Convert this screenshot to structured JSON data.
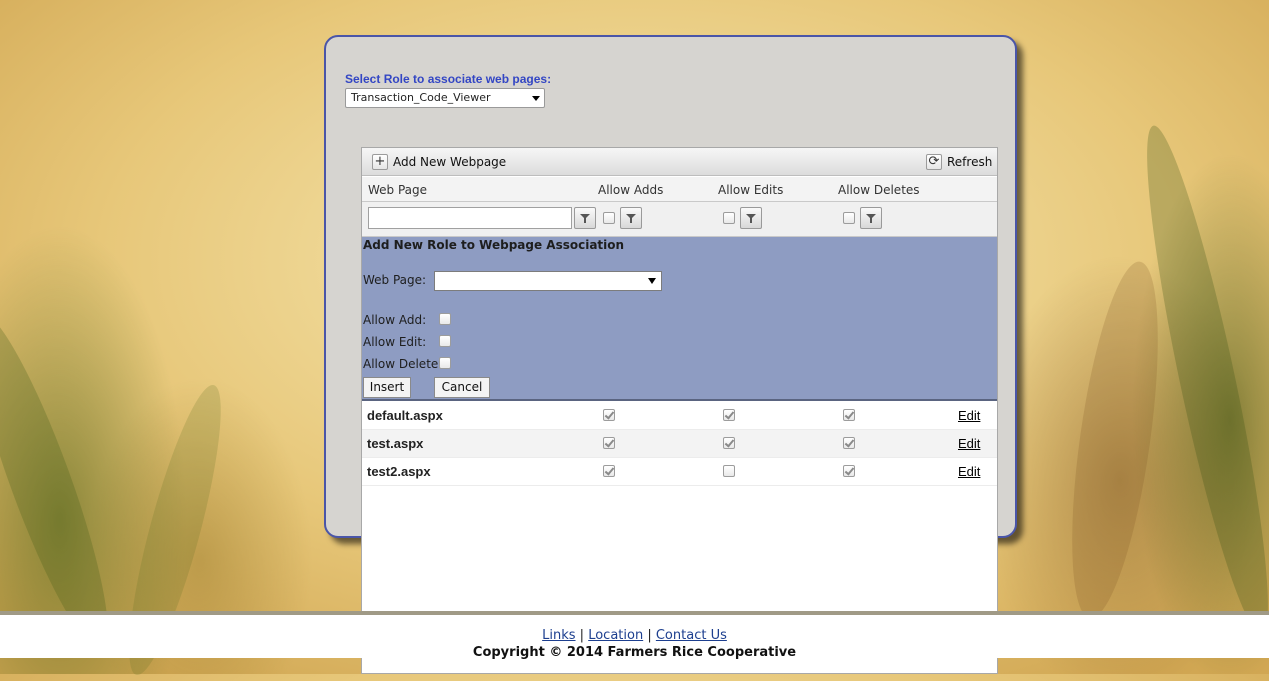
{
  "role_select": {
    "label": "Select Role to associate web pages:",
    "value": "Transaction_Code_Viewer"
  },
  "grid": {
    "toolbar": {
      "add_label": "Add New Webpage",
      "refresh_label": "Refresh"
    },
    "columns": [
      "Web Page",
      "Allow Adds",
      "Allow Edits",
      "Allow Deletes"
    ],
    "filter": {
      "webpage_value": "",
      "allow_adds": false,
      "allow_edits": false,
      "allow_deletes": false
    },
    "insert_form": {
      "title": "Add New Role to Webpage Association",
      "webpage_label": "Web Page:",
      "webpage_value": "",
      "allow_add_label": "Allow Add:",
      "allow_edit_label": "Allow Edit:",
      "allow_delete_label": "Allow Delete:",
      "allow_add": false,
      "allow_edit": false,
      "allow_delete": false,
      "insert_label": "Insert",
      "cancel_label": "Cancel"
    },
    "rows": [
      {
        "page": "default.aspx",
        "adds": true,
        "edits": true,
        "deletes": true,
        "action": "Edit"
      },
      {
        "page": "test.aspx",
        "adds": true,
        "edits": true,
        "deletes": true,
        "action": "Edit"
      },
      {
        "page": "test2.aspx",
        "adds": true,
        "edits": false,
        "deletes": true,
        "action": "Edit"
      }
    ]
  },
  "footer": {
    "links": [
      "Links",
      "Location",
      "Contact Us"
    ],
    "separator": "|",
    "copyright": "Copyright © 2014 Farmers Rice Cooperative"
  },
  "colors": {
    "panel_bg": "#d6d4d0",
    "panel_border": "#4a55a8",
    "insert_form_bg": "#8e9cc2",
    "label_blue": "#3346c4"
  }
}
